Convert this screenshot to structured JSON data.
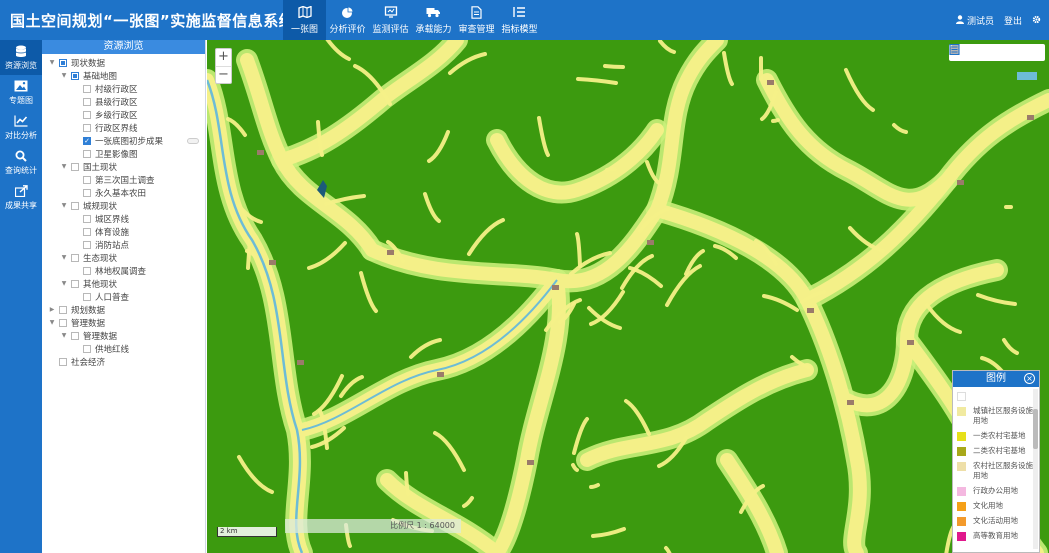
{
  "app": {
    "title": "国土空间规划“一张图”实施监督信息系统"
  },
  "nav": [
    {
      "label": "一张图",
      "icon": "map-icon",
      "active": true
    },
    {
      "label": "分析评价",
      "icon": "pie-chart-icon"
    },
    {
      "label": "监测评估",
      "icon": "monitor-icon"
    },
    {
      "label": "承载能力",
      "icon": "truck-icon"
    },
    {
      "label": "审查管理",
      "icon": "document-icon"
    },
    {
      "label": "指标模型",
      "icon": "list-icon"
    }
  ],
  "user": {
    "name": "测试员",
    "logout": "登出"
  },
  "rail": [
    {
      "label": "资源浏览",
      "icon": "database-icon",
      "active": true
    },
    {
      "label": "专题图",
      "icon": "image-icon"
    },
    {
      "label": "对比分析",
      "icon": "line-chart-icon"
    },
    {
      "label": "查询统计",
      "icon": "search-icon"
    },
    {
      "label": "成果共享",
      "icon": "share-icon"
    }
  ],
  "panel": {
    "title": "资源浏览"
  },
  "tree": [
    {
      "label": "现状数据",
      "level": 0,
      "toggle": "▼",
      "state": "partial"
    },
    {
      "label": "基础地图",
      "level": 1,
      "toggle": "▼",
      "state": "partial"
    },
    {
      "label": "村级行政区",
      "level": 2,
      "state": "none"
    },
    {
      "label": "县级行政区",
      "level": 2,
      "state": "none"
    },
    {
      "label": "乡级行政区",
      "level": 2,
      "state": "none"
    },
    {
      "label": "行政区界线",
      "level": 2,
      "state": "none"
    },
    {
      "label": "一张底图初步成果",
      "level": 2,
      "state": "checked",
      "switch": true
    },
    {
      "label": "卫星影像图",
      "level": 2,
      "state": "none"
    },
    {
      "label": "国土现状",
      "level": 1,
      "toggle": "▼",
      "state": "none"
    },
    {
      "label": "第三次国土调查",
      "level": 2,
      "state": "none"
    },
    {
      "label": "永久基本农田",
      "level": 2,
      "state": "none"
    },
    {
      "label": "城规现状",
      "level": 1,
      "toggle": "▼",
      "state": "none"
    },
    {
      "label": "城区界线",
      "level": 2,
      "state": "none"
    },
    {
      "label": "体育设施",
      "level": 2,
      "state": "none"
    },
    {
      "label": "消防站点",
      "level": 2,
      "state": "none"
    },
    {
      "label": "生态现状",
      "level": 1,
      "toggle": "▼",
      "state": "none"
    },
    {
      "label": "林地权属调查",
      "level": 2,
      "state": "none"
    },
    {
      "label": "其他现状",
      "level": 1,
      "toggle": "▼",
      "state": "none"
    },
    {
      "label": "人口普查",
      "level": 2,
      "state": "none"
    },
    {
      "label": "规划数据",
      "level": 0,
      "toggle": "▶",
      "state": "none"
    },
    {
      "label": "管理数据",
      "level": 0,
      "toggle": "▼",
      "state": "none"
    },
    {
      "label": "管理数据",
      "level": 1,
      "toggle": "▼",
      "state": "none"
    },
    {
      "label": "供地红线",
      "level": 2,
      "state": "none"
    },
    {
      "label": "社会经济",
      "level": 0,
      "state": "none"
    }
  ],
  "map": {
    "zoom_in": "+",
    "zoom_out": "−",
    "scale_bar": "2 km",
    "scale_text": "比例尺 1 : 64000",
    "tools": [
      "home-icon",
      "info-icon",
      "bar-chart-icon",
      "share-icon",
      "layers-icon"
    ],
    "colors": {
      "forest": "#3c9a0f",
      "farmland": "#f4f088",
      "grassland": "#c9ef7a",
      "water": "#6dbcd6",
      "settlement": "#9a7b6a"
    }
  },
  "legend": {
    "title": "图例",
    "close": "×",
    "items": [
      {
        "label": "",
        "color": "#ffffff"
      },
      {
        "label": "城镇社区服务设施用地",
        "color": "#f1eaa0"
      },
      {
        "label": "一类农村宅基地",
        "color": "#e6e01a"
      },
      {
        "label": "二类农村宅基地",
        "color": "#a8a81a"
      },
      {
        "label": "农村社区服务设施用地",
        "color": "#eedfa8"
      },
      {
        "label": "行政办公用地",
        "color": "#f4b8e0"
      },
      {
        "label": "文化用地",
        "color": "#f5a018"
      },
      {
        "label": "文化活动用地",
        "color": "#f39a2c"
      },
      {
        "label": "高等教育用地",
        "color": "#e0188c"
      }
    ]
  }
}
